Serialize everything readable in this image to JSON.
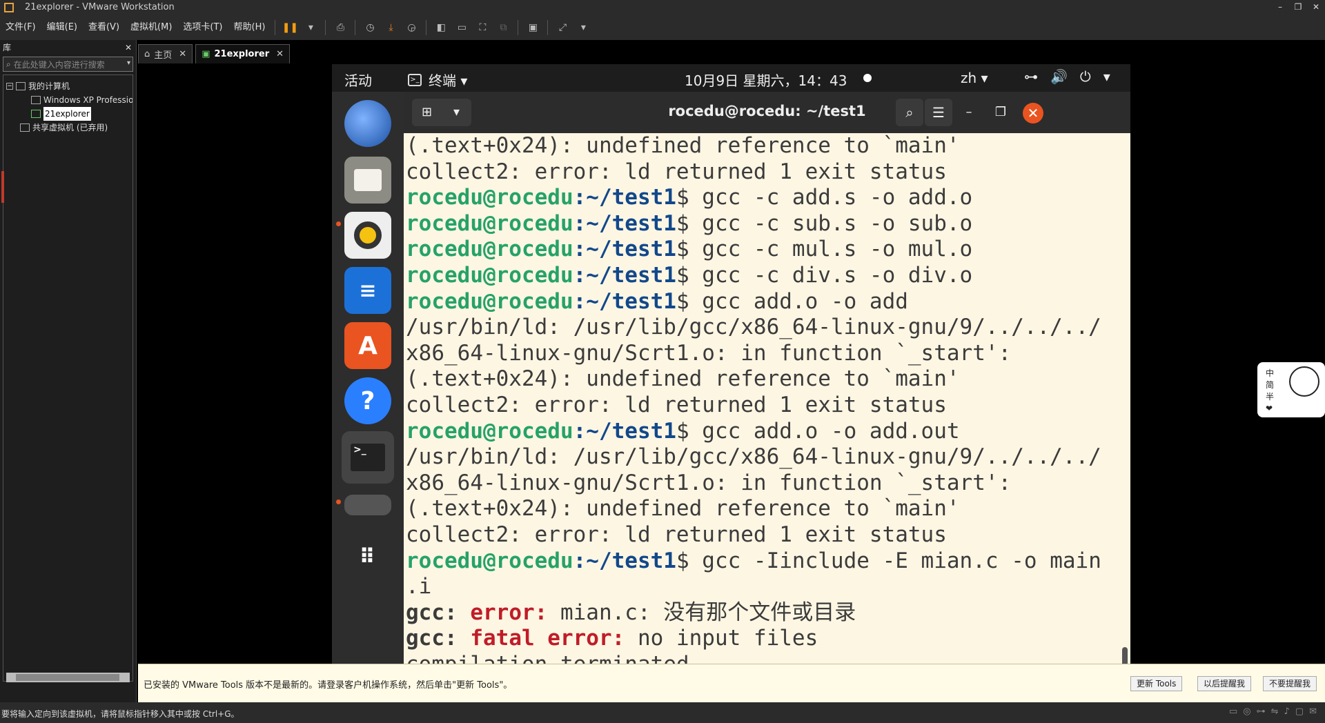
{
  "window": {
    "title": "21explorer - VMware Workstation",
    "controls": [
      "–",
      "❐",
      "✕"
    ]
  },
  "menubar": {
    "items": [
      "文件(F)",
      "编辑(E)",
      "查看(V)",
      "虚拟机(M)",
      "选项卡(T)",
      "帮助(H)"
    ]
  },
  "library": {
    "title": "库",
    "close": "✕",
    "search_placeholder": "在此处键入内容进行搜索",
    "tree": [
      {
        "label": "我的计算机"
      },
      {
        "label": "Windows XP Professio"
      },
      {
        "label": "21explorer"
      },
      {
        "label": "共享虚拟机 (已弃用)"
      }
    ]
  },
  "tabs": [
    {
      "label": "主页",
      "icon": "home-icon",
      "close": "✕"
    },
    {
      "label": "21explorer",
      "icon": "vm-icon",
      "close": "✕"
    }
  ],
  "ubuntu": {
    "topbar": {
      "activities": "活动",
      "app": "终端 ▾",
      "clock": "10月9日 星期六，14：43",
      "lang": "zh ▾"
    },
    "terminal": {
      "title": "rocedu@rocedu: ~/test1",
      "prompt_user": "rocedu@rocedu",
      "prompt_path": ":~/test1",
      "lines": [
        {
          "text": "(.text+0x24): undefined reference to `main'"
        },
        {
          "text": "collect2: error: ld returned 1 exit status"
        },
        {
          "cmd": "$ gcc -c add.s -o add.o"
        },
        {
          "cmd": "$ gcc -c sub.s -o sub.o"
        },
        {
          "cmd": "$ gcc -c mul.s -o mul.o"
        },
        {
          "cmd": "$ gcc -c div.s -o div.o"
        },
        {
          "cmd": "$ gcc add.o -o add"
        },
        {
          "text": "/usr/bin/ld: /usr/lib/gcc/x86_64-linux-gnu/9/../../../"
        },
        {
          "text": "x86_64-linux-gnu/Scrt1.o: in function `_start':"
        },
        {
          "text": "(.text+0x24): undefined reference to `main'"
        },
        {
          "text": "collect2: error: ld returned 1 exit status"
        },
        {
          "cmd": "$ gcc add.o -o add.out"
        },
        {
          "text": "/usr/bin/ld: /usr/lib/gcc/x86_64-linux-gnu/9/../../../"
        },
        {
          "text": "x86_64-linux-gnu/Scrt1.o: in function `_start':"
        },
        {
          "text": "(.text+0x24): undefined reference to `main'"
        },
        {
          "text": "collect2: error: ld returned 1 exit status"
        },
        {
          "cmd": "$ gcc -Iinclude -E mian.c -o main"
        },
        {
          "text": ".i"
        },
        {
          "gcc": "gcc: ",
          "err": "error: ",
          "rest": "mian.c: 没有那个文件或目录"
        },
        {
          "gcc": "gcc: ",
          "err": "fatal error: ",
          "rest": "no input files"
        },
        {
          "text": "compilation terminated."
        }
      ]
    }
  },
  "notification": {
    "message": "已安装的 VMware Tools 版本不是最新的。请登录客户机操作系统，然后单击\"更新 Tools\"。",
    "buttons": [
      "更新 Tools",
      "以后提醒我",
      "不要提醒我"
    ]
  },
  "ime_widget": {
    "chars": [
      "中",
      "简",
      "半",
      "❤"
    ]
  },
  "statusbar": {
    "text": "要将输入定向到该虚拟机，请将鼠标指针移入其中或按 Ctrl+G。"
  },
  "colors": {
    "prompt_user": "#26a269",
    "prompt_path": "#12488b",
    "error": "#c01c28",
    "terminal_bg": "#fdf6e3",
    "ubuntu_orange": "#e95420"
  }
}
